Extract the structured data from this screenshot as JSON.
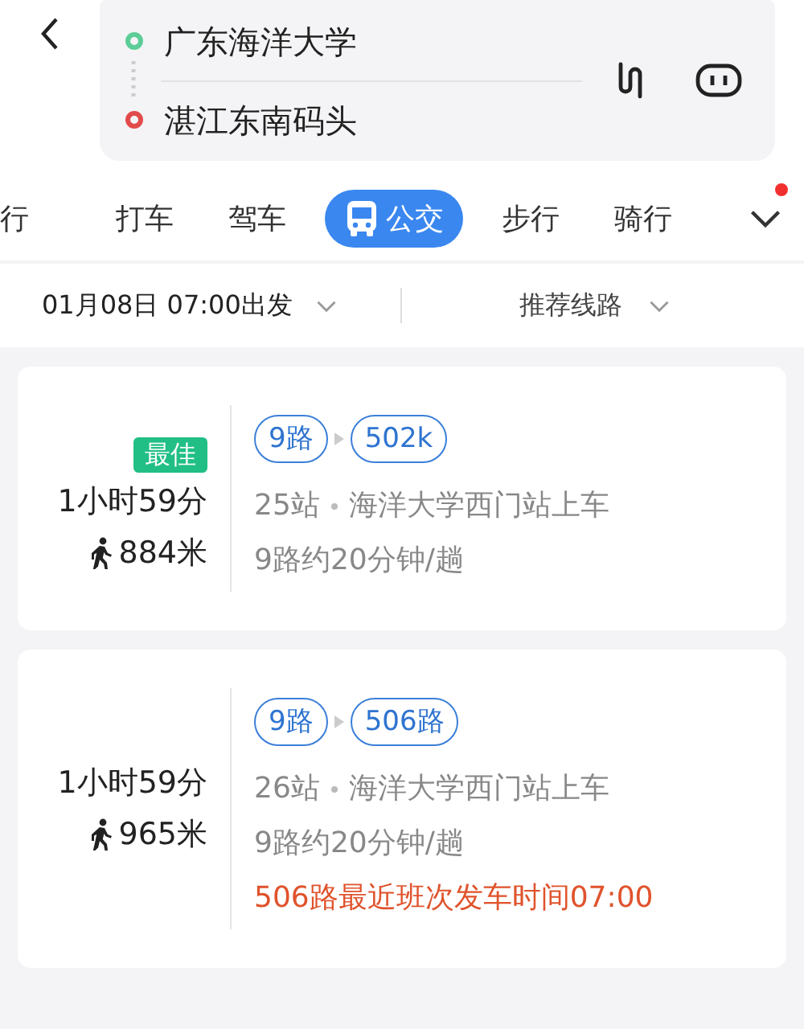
{
  "trip": {
    "origin": "广东海洋大学",
    "destination": "湛江东南码头"
  },
  "tabs": [
    {
      "label": "行",
      "selected": false
    },
    {
      "label": "打车",
      "selected": false
    },
    {
      "label": "驾车",
      "selected": false
    },
    {
      "label": "公交",
      "selected": true
    },
    {
      "label": "步行",
      "selected": false
    },
    {
      "label": "骑行",
      "selected": false
    }
  ],
  "more_tabs": {
    "notification": true
  },
  "filters": {
    "departure": "01月08日 07:00出发",
    "sort": "推荐线路"
  },
  "routes": [
    {
      "badge": "最佳",
      "duration": "1小时59分",
      "walk": "884米",
      "lines": [
        "9路",
        "502k"
      ],
      "stops": "25站",
      "boarding": "海洋大学西门站上车",
      "frequency": "9路约20分钟/趟"
    },
    {
      "duration": "1小时59分",
      "walk": "965米",
      "lines": [
        "9路",
        "506路"
      ],
      "stops": "26站",
      "boarding": "海洋大学西门站上车",
      "frequency": "9路约20分钟/趟",
      "notice": "506路最近班次发车时间07:00"
    }
  ]
}
